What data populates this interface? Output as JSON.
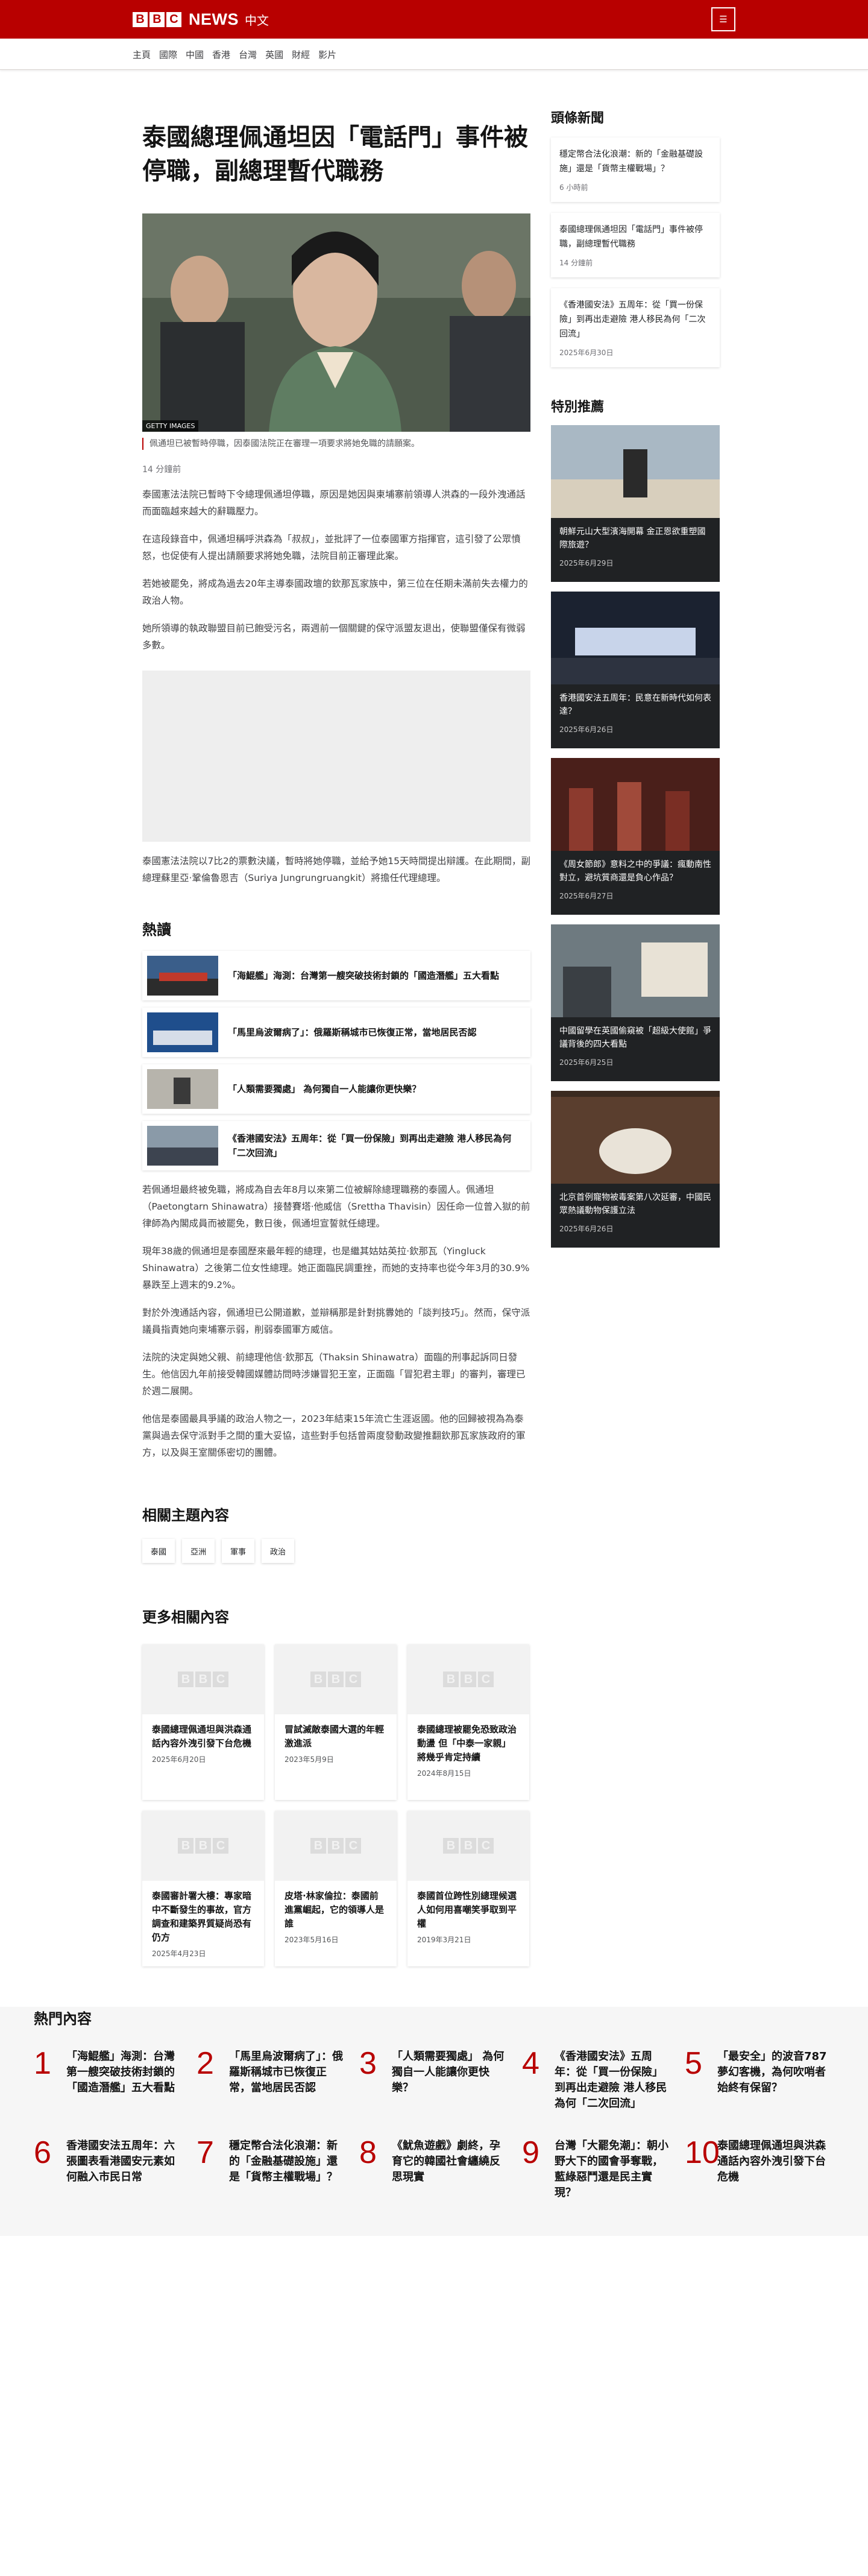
{
  "header": {
    "logo_letters": [
      "B",
      "B",
      "C"
    ],
    "brand": "NEWS",
    "lang": "中文",
    "menu_icon": "menu-icon",
    "menu_glyph": "☰"
  },
  "nav": [
    "主頁",
    "國際",
    "中國",
    "香港",
    "台灣",
    "英國",
    "財經",
    "影片"
  ],
  "article": {
    "headline": "泰國總理佩通坦因「電話門」事件被停職，副總理暫代職務",
    "image_credit": "GETTY IMAGES",
    "caption": "佩通坦已被暫時停職，因泰國法院正在審理一項要求將她免職的請願案。",
    "timestamp": "14 分鐘前",
    "paragraphs_1": [
      "泰國憲法法院已暫時下令總理佩通坦停職，原因是她因與柬埔寨前領導人洪森的一段外洩通話而面臨越來越大的辭職壓力。",
      "在這段錄音中，佩通坦稱呼洪森為「叔叔」，並批評了一位泰國軍方指揮官，這引發了公眾憤怒，也促使有人提出請願要求將她免職，法院目前正審理此案。",
      "若她被罷免，將成為過去20年主導泰國政壇的欽那瓦家族中，第三位在任期未滿前失去權力的政治人物。",
      "她所領導的執政聯盟目前已飽受污名，兩週前一個關鍵的保守派盟友退出，使聯盟僅保有微弱多數。"
    ],
    "paragraph_after_ad": "泰國憲法法院以7比2的票數決議，暫時將她停職，並給予她15天時間提出辯護。在此期間，副總理蘇里亞·鞏倫魯恩吉（Suriya Jungrungruangkit）將擔任代理總理。",
    "hot_heading": "熱讀",
    "hot_items": [
      "「海鯤艦」海測：台灣第一艘突破技術封鎖的「國造潛艦」五大看點",
      "「馬里烏波爾病了」：俄羅斯稱城市已恢復正常，當地居民否認",
      "「人類需要獨處」 為何獨自一人能讓你更快樂？",
      "《香港國安法》五周年：從「買一份保險」到再出走避險 港人移民為何「二次回流」"
    ],
    "paragraphs_2": [
      "若佩通坦最終被免職，將成為自去年8月以來第二位被解除總理職務的泰國人。佩通坦（Paetongtarn Shinawatra）接替賽塔·他威信（Srettha Thavisin）因任命一位曾入獄的前律師為內閣成員而被罷免，數日後，佩通坦宣誓就任總理。",
      "現年38歲的佩通坦是泰國歷來最年輕的總理，也是繼其姑姑英拉·欽那瓦（Yingluck Shinawatra）之後第二位女性總理。她正面臨民調重挫，而她的支持率也從今年3月的30.9%暴跌至上週末的9.2%。",
      "對於外洩通話內容，佩通坦已公開道歉，並辯稱那是針對挑釁她的「談判技巧」。然而，保守派議員指責她向柬埔寨示弱，削弱泰國軍方威信。",
      "法院的決定與她父親、前總理他信·欽那瓦（Thaksin Shinawatra）面臨的刑事起訴同日發生。他信因九年前接受韓國媒體訪問時涉嫌冒犯王室，正面臨「冒犯君主罪」的審判，審理已於週二展開。",
      "他信是泰國最具爭議的政治人物之一，2023年結束15年流亡生涯返國。他的回歸被視為為泰黨與過去保守派對手之間的重大妥協，這些對手包括曾兩度發動政變推翻欽那瓦家族政府的軍方，以及與王室關係密切的團體。"
    ],
    "topics_heading": "相關主題內容",
    "topics": [
      "泰國",
      "亞洲",
      "軍事",
      "政治"
    ],
    "more_heading": "更多相關內容",
    "related": [
      {
        "title": "泰國總理佩通坦與洪森通話內容外洩引發下台危機",
        "date": "2025年6月20日"
      },
      {
        "title": "冒試滅敵泰國大選的年輕激進派",
        "date": "2023年5月9日"
      },
      {
        "title": "泰國總理被罷免恐致政治動盪 但「中泰一家親」將幾乎肯定持續",
        "date": "2024年8月15日"
      },
      {
        "title": "泰國審計署大樓：專家暗中不斷發生的事故，官方調查和建築界質疑尚恐有仍方",
        "date": "2025年4月23日"
      },
      {
        "title": "皮塔·林家倫拉：泰國前進黨崛起，它的領導人是誰",
        "date": "2023年5月16日"
      },
      {
        "title": "泰國首位跨性別總理候選人如何用喜嘲笑爭取到平權",
        "date": "2019年3月21日"
      }
    ]
  },
  "sidebar": {
    "top_heading": "頭條新聞",
    "top_stories": [
      {
        "title": "穩定幣合法化浪潮：新的「金融基礎設施」還是「貨幣主權戰場」？",
        "date": "6 小時前"
      },
      {
        "title": "泰國總理佩通坦因「電話門」事件被停職，副總理暫代職務",
        "date": "14 分鐘前"
      },
      {
        "title": "《香港國安法》五周年：從「買一份保險」到再出走避險 港人移民為何「二次回流」",
        "date": "2025年6月30日"
      }
    ],
    "feature_heading": "特別推薦",
    "features": [
      {
        "title": "朝鮮元山大型濱海開幕 金正恩欲重塑國際旅遊？",
        "date": "2025年6月29日"
      },
      {
        "title": "香港國安法五周年：民意在新時代如何表達？",
        "date": "2025年6月26日"
      },
      {
        "title": "《周女節郎》意料之中的爭議：瘋動南性對立，避坑質商還是負心作品？",
        "date": "2025年6月27日"
      },
      {
        "title": "中國留學在英國偷窺被「超級大使館」爭議背後的四大看點",
        "date": "2025年6月25日"
      },
      {
        "title": "北京首例寵物被毒案第八次延審，中國民眾熱議動物保護立法",
        "date": "2025年6月26日"
      }
    ]
  },
  "popular": {
    "heading": "熱門內容",
    "items": [
      {
        "num": "1",
        "title": "「海鯤艦」海測：台灣第一艘突破技術封鎖的「國造潛艦」五大看點"
      },
      {
        "num": "2",
        "title": "「馬里烏波爾病了」：俄羅斯稱城市已恢復正常，當地居民否認"
      },
      {
        "num": "3",
        "title": "「人類需要獨處」 為何獨自一人能讓你更快樂？"
      },
      {
        "num": "4",
        "title": "《香港國安法》五周年：從「買一份保險」到再出走避險 港人移民為何「二次回流」"
      },
      {
        "num": "5",
        "title": "「最安全」的波音787夢幻客機，為何吹哨者始終有保留？"
      },
      {
        "num": "6",
        "title": "香港國安法五周年：六張圖表看港國安元素如何融入市民日常"
      },
      {
        "num": "7",
        "title": "穩定幣合法化浪潮：新的「金融基礎設施」還是「貨幣主權戰場」？"
      },
      {
        "num": "8",
        "title": "《魷魚遊戲》劇終，孕育它的韓國社會纏繞反思現實"
      },
      {
        "num": "9",
        "title": "台灣「大罷免潮」：朝小野大下的國會爭奪戰，藍綠惡鬥還是民主實現？"
      },
      {
        "num": "10",
        "title": "泰國總理佩通坦與洪森通話內容外洩引發下台危機"
      }
    ]
  },
  "colors": {
    "brand_red": "#b80000",
    "page_bg": "#ffffff",
    "feature_bg": "#202224"
  }
}
